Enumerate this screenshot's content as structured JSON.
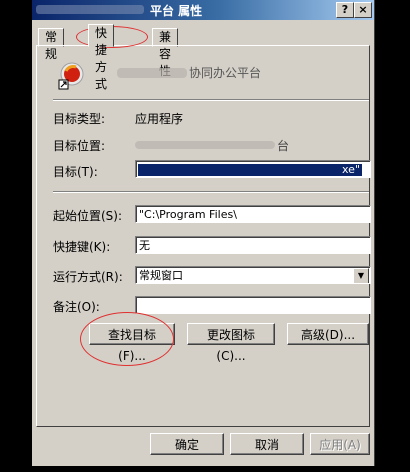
{
  "window": {
    "title": "平台 属性",
    "help_label": "?",
    "close_label": "×"
  },
  "tabs": [
    {
      "label": "常规"
    },
    {
      "label": "快捷方式"
    },
    {
      "label": "兼容性"
    }
  ],
  "app": {
    "name": "协同办公平台"
  },
  "props": {
    "target_type_label": "目标类型:",
    "target_type_value": "应用程序",
    "target_location_label": "目标位置:",
    "target_location_value": "台",
    "target_label": "目标(T):",
    "target_value": "xe\"",
    "start_in_label": "起始位置(S):",
    "start_in_value": "\"C:\\Program Files\\",
    "hotkey_label": "快捷键(K):",
    "hotkey_value": "无",
    "run_label": "运行方式(R):",
    "run_value": "常规窗口",
    "comment_label": "备注(O):",
    "comment_value": ""
  },
  "buttons": {
    "find_target": "查找目标(F)...",
    "change_icon": "更改图标(C)...",
    "advanced": "高级(D)...",
    "ok": "确定",
    "cancel": "取消",
    "apply": "应用(A)"
  },
  "colors": {
    "face": "#d4d0c8",
    "titlebar_start": "#0a246a",
    "selection": "#0a246a",
    "annotation": "#e03030"
  }
}
